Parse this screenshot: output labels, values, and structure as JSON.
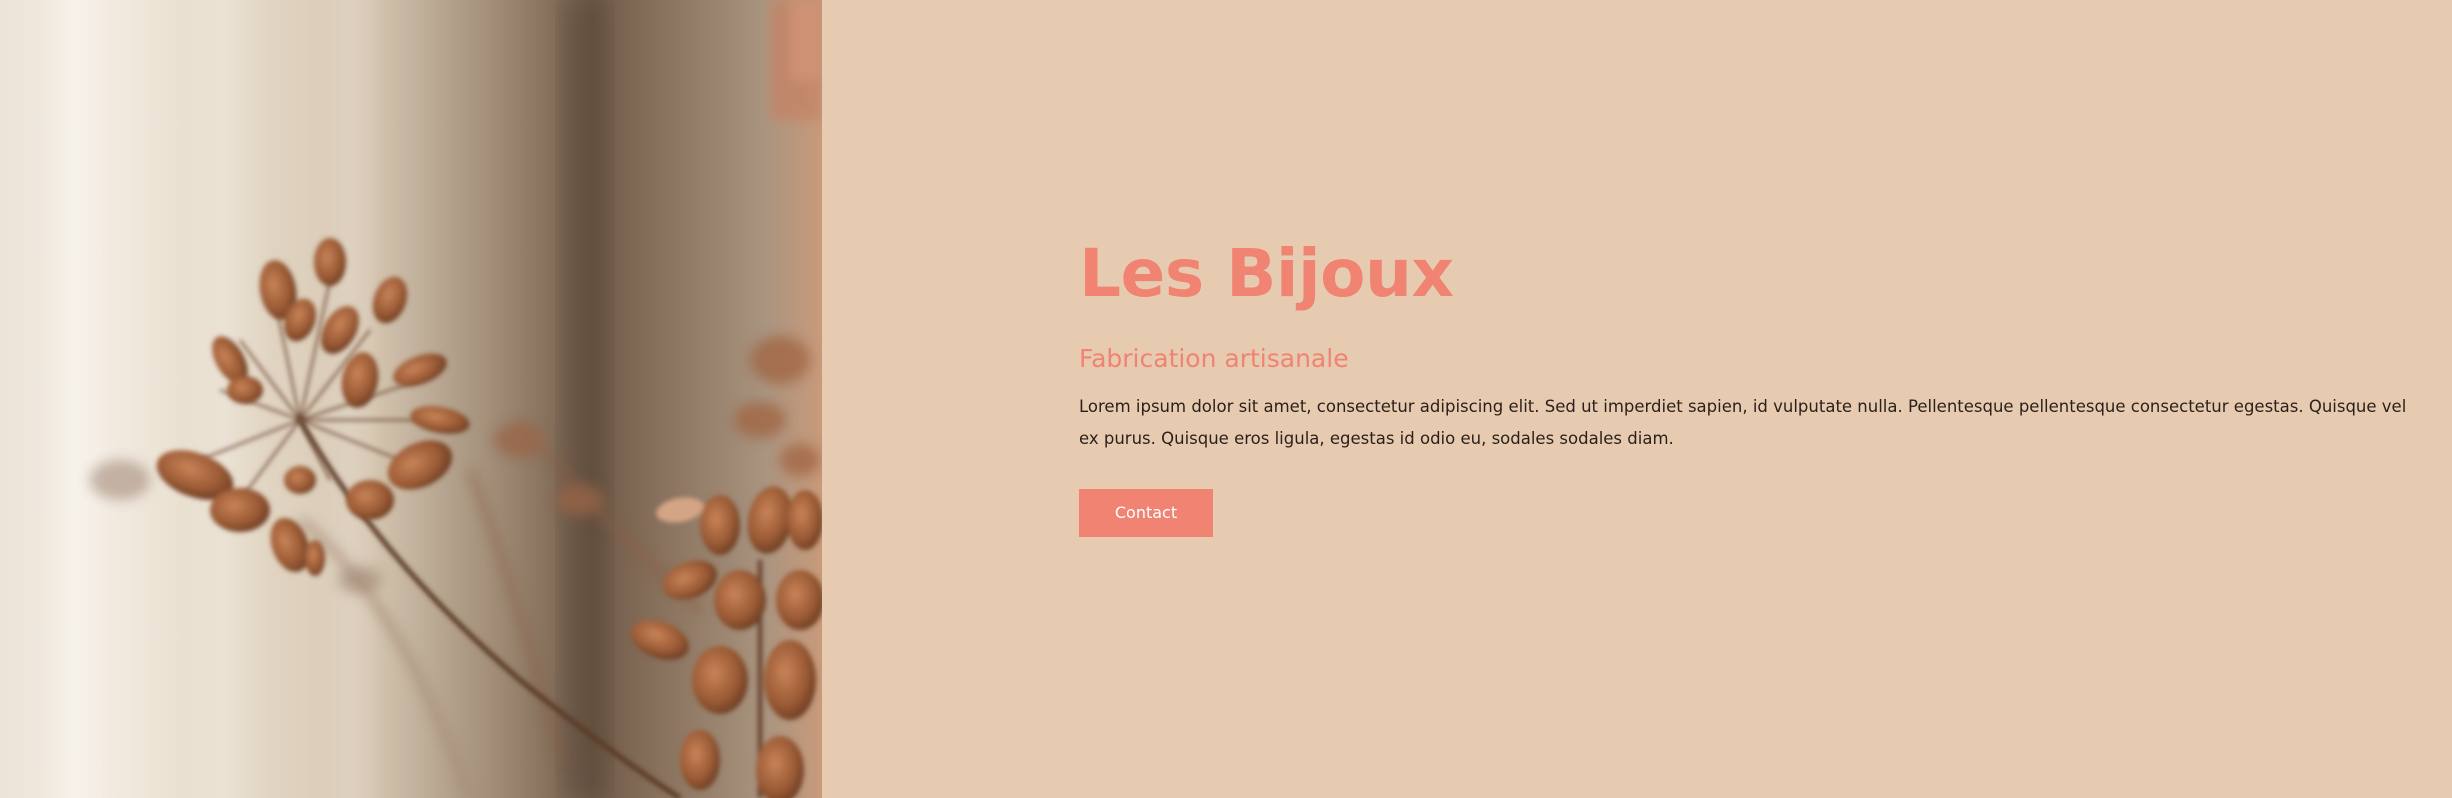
{
  "hero": {
    "image_alt": "dried-flowers-photo",
    "title": "Les Bijoux",
    "subtitle": "Fabrication artisanale",
    "body": "Lorem ipsum dolor sit amet, consectetur adipiscing elit. Sed ut imperdiet sapien, id vulputate nulla. Pellentesque pellentesque consectetur egestas. Quisque vel ex purus. Quisque eros ligula, egestas id odio eu, sodales sodales diam.",
    "button_label": "Contact"
  },
  "colors": {
    "background": "#e6cbb1",
    "accent": "#f08371",
    "text": "#2a1f1a",
    "button_text": "#ffffff"
  }
}
